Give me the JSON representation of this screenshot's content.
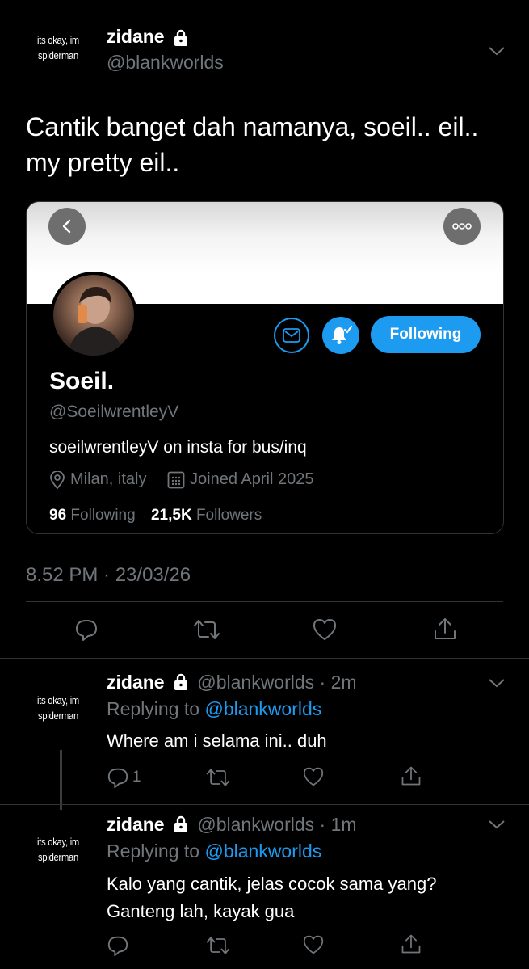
{
  "main_tweet": {
    "avatar_text": "its okay, im spiderman",
    "name": "zidane",
    "handle": "@blankworlds",
    "text_line1": "Cantik banget dah namanya, soeil.. eil..",
    "text_line2": "my pretty eil..",
    "timestamp": "8.52 PM · 23/03/26"
  },
  "profile_card": {
    "name": "Soeil.",
    "handle": "@SoeilwrentleyV",
    "bio": "soeilwrentleyV on insta for bus/inq",
    "location": "Milan, italy",
    "joined": "Joined April 2025",
    "following_count": "96",
    "following_label": "Following",
    "followers_count": "21,5K",
    "followers_label": "Followers",
    "follow_button": "Following"
  },
  "replies": [
    {
      "avatar_text": "its okay, im spiderman",
      "name": "zidane",
      "handle": "@blankworlds",
      "time": "· 2m",
      "replying_prefix": "Replying to",
      "replying_to": "@blankworlds",
      "text_line1": "Where am i selama ini.. duh",
      "text_line2": "",
      "reply_count": "1"
    },
    {
      "avatar_text": "its okay, im spiderman",
      "name": "zidane",
      "handle": "@blankworlds",
      "time": "· 1m",
      "replying_prefix": "Replying to",
      "replying_to": "@blankworlds",
      "text_line1": "Kalo yang cantik, jelas cocok sama yang?",
      "text_line2": "Ganteng lah, kayak gua",
      "reply_count": ""
    }
  ],
  "colors": {
    "background": "#000000",
    "accent": "#1d9bf0",
    "muted": "#71767b"
  }
}
